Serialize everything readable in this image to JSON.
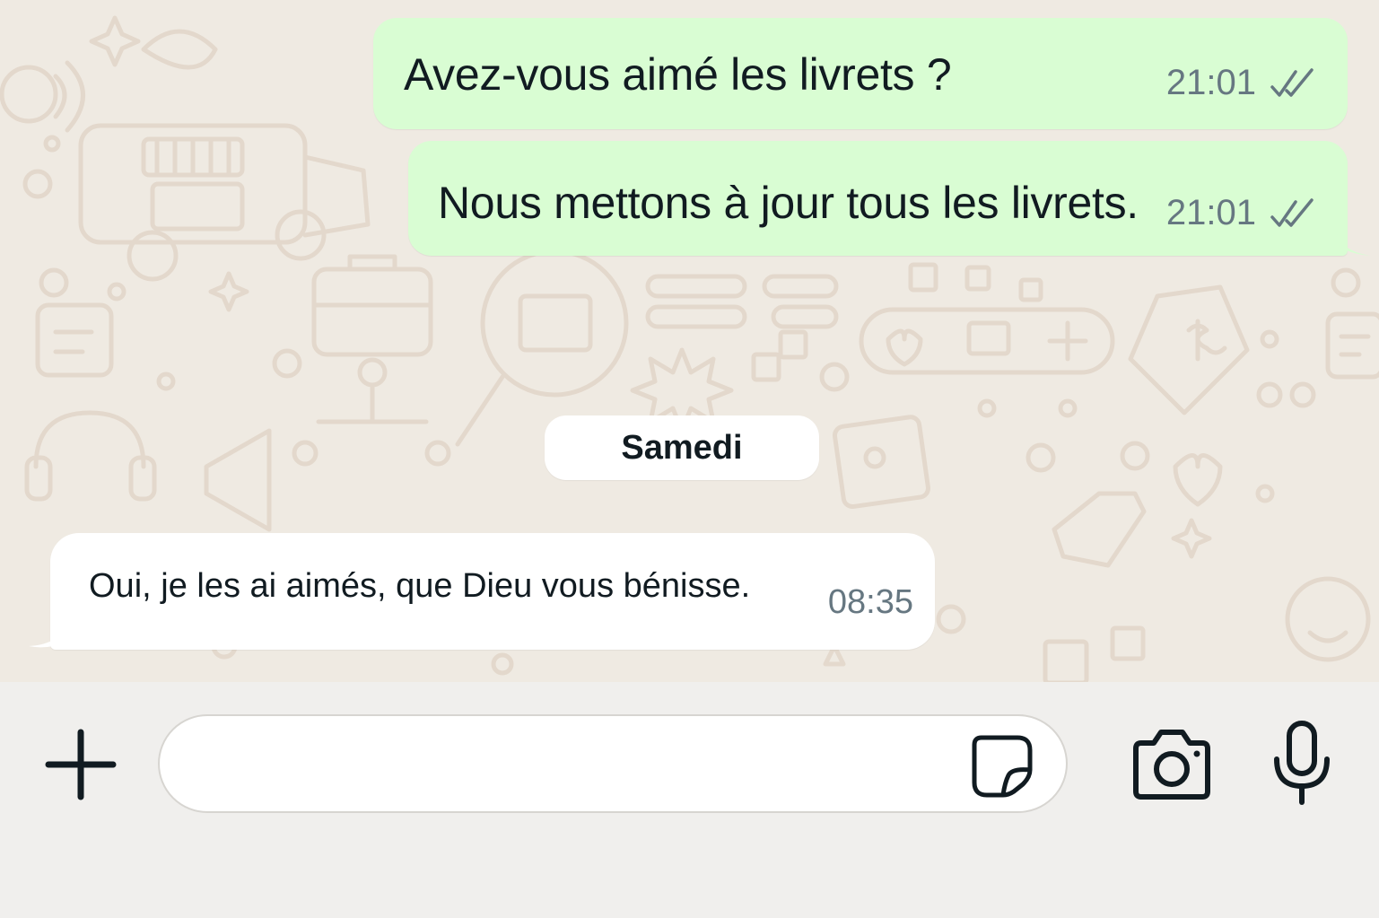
{
  "messages_outgoing": [
    {
      "text": "Avez-vous aimé les livrets ?",
      "time": "21:01",
      "status_icon": "double-check-icon"
    },
    {
      "text": "Nous mettons à jour tous les livrets.",
      "time": "21:01",
      "status_icon": "double-check-icon"
    }
  ],
  "date_separator": {
    "label": "Samedi"
  },
  "messages_incoming": [
    {
      "text": "Oui, je les ai aimés, que Dieu vous bénisse.",
      "time": "08:35"
    }
  ],
  "composer": {
    "placeholder": "",
    "value": "",
    "attach_icon": "plus-icon",
    "sticker_icon": "sticker-icon",
    "camera_icon": "camera-icon",
    "mic_icon": "microphone-icon"
  },
  "colors": {
    "wallpaper": "#efeae2",
    "outgoing_bubble": "#d9fdd3",
    "incoming_bubble": "#ffffff",
    "meta_text": "#667781",
    "primary_text": "#111b21"
  }
}
